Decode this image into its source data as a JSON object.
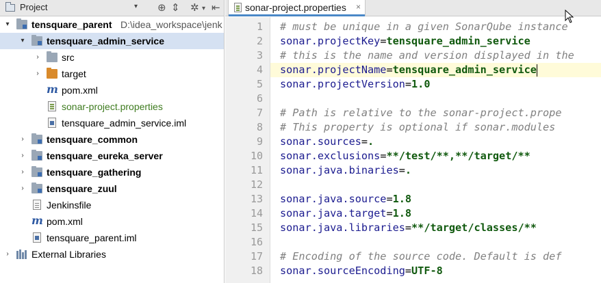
{
  "project_panel": {
    "title": "Project",
    "dropdown": "▾",
    "header_icons": [
      "target-icon",
      "collapse-icon",
      "gear-icon",
      "hide-icon"
    ],
    "tree": [
      {
        "label": "tensquare_parent",
        "path": "D:\\idea_workspace\\jenk",
        "indent": 0,
        "arrow": "▾",
        "icon": "module-folder-icon",
        "bold": true
      },
      {
        "label": "tensquare_admin_service",
        "indent": 1,
        "arrow": "▾",
        "icon": "module-folder-icon",
        "bold": true,
        "selected": true
      },
      {
        "label": "src",
        "indent": 2,
        "arrow": "›",
        "icon": "folder-icon"
      },
      {
        "label": "target",
        "indent": 2,
        "arrow": "›",
        "icon": "excluded-folder-icon"
      },
      {
        "label": "pom.xml",
        "indent": 2,
        "icon": "maven-icon"
      },
      {
        "label": "sonar-project.properties",
        "indent": 2,
        "icon": "properties-file-icon",
        "green": true
      },
      {
        "label": "tensquare_admin_service.iml",
        "indent": 2,
        "icon": "iml-file-icon"
      },
      {
        "label": "tensquare_common",
        "indent": 1,
        "arrow": "›",
        "icon": "module-folder-icon",
        "bold": true
      },
      {
        "label": "tensquare_eureka_server",
        "indent": 1,
        "arrow": "›",
        "icon": "module-folder-icon",
        "bold": true
      },
      {
        "label": "tensquare_gathering",
        "indent": 1,
        "arrow": "›",
        "icon": "module-folder-icon",
        "bold": true
      },
      {
        "label": "tensquare_zuul",
        "indent": 1,
        "arrow": "›",
        "icon": "module-folder-icon",
        "bold": true
      },
      {
        "label": "Jenkinsfile",
        "indent": 1,
        "icon": "text-file-icon"
      },
      {
        "label": "pom.xml",
        "indent": 1,
        "icon": "maven-icon"
      },
      {
        "label": "tensquare_parent.iml",
        "indent": 1,
        "icon": "iml-file-icon"
      },
      {
        "label": "External Libraries",
        "indent": 0,
        "arrow": "›",
        "icon": "libraries-icon"
      }
    ]
  },
  "editor": {
    "tab": {
      "label": "sonar-project.properties",
      "close": "×"
    },
    "highlighted_line": 4,
    "lines": [
      {
        "n": "1",
        "comment": "# must be unique in a given SonarQube instance"
      },
      {
        "n": "2",
        "key": "sonar.projectKey",
        "value": "tensquare_admin_service"
      },
      {
        "n": "3",
        "comment": "# this is the name and version displayed in the"
      },
      {
        "n": "4",
        "key": "sonar.projectName",
        "value": "tensquare_admin_service"
      },
      {
        "n": "5",
        "key": "sonar.projectVersion",
        "value": "1.0"
      },
      {
        "n": "6"
      },
      {
        "n": "7",
        "comment": "# Path is relative to the sonar-project.prope"
      },
      {
        "n": "8",
        "comment": "# This property is optional if sonar.modules"
      },
      {
        "n": "9",
        "key": "sonar.sources",
        "value": "."
      },
      {
        "n": "10",
        "key": "sonar.exclusions",
        "value": "**/test/**,**/target/**"
      },
      {
        "n": "11",
        "key": "sonar.java.binaries",
        "value": "."
      },
      {
        "n": "12"
      },
      {
        "n": "13",
        "key": "sonar.java.source",
        "value": "1.8"
      },
      {
        "n": "14",
        "key": "sonar.java.target",
        "value": "1.8"
      },
      {
        "n": "15",
        "key": "sonar.java.libraries",
        "value": "**/target/classes/**"
      },
      {
        "n": "16"
      },
      {
        "n": "17",
        "comment": "# Encoding of the source code. Default is def"
      },
      {
        "n": "18",
        "key": "sonar.sourceEncoding",
        "value": "UTF-8"
      }
    ]
  },
  "colors": {
    "selection": "#d5e1f2",
    "line_highlight": "#fffbd9",
    "key": "#1b1b8f",
    "value": "#10590e",
    "comment": "#808080",
    "tab_underline": "#4a88c7"
  }
}
